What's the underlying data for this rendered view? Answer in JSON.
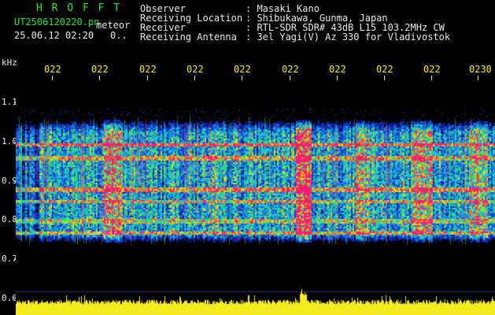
{
  "header": {
    "brand": "H R O F F T",
    "file_name": "UT2506120220.pn",
    "file_tag": "meteor",
    "date_time": "25.06.12 02:20",
    "count": "0..",
    "fields": [
      {
        "label": "Observer",
        "value": "Masaki Kano"
      },
      {
        "label": "Receiving Location",
        "value": "Shibukawa, Gunma, Japan"
      },
      {
        "label": "Receiver",
        "value": "RTL-SDR SDR# 43dB L15 103.2MHz CW"
      },
      {
        "label": "Receiving Antenna",
        "value": "3el Yagi(V) Az 330 for Vladivostok"
      }
    ]
  },
  "spectrogram": {
    "unit_label": "kHz",
    "faint_label": "meteor",
    "y_ticks": [
      "1.1",
      "1.0",
      "0.9",
      "0.8",
      "0.7",
      "0.6"
    ],
    "x_ticks": [
      "022",
      "022",
      "022",
      "022",
      "022",
      "022",
      "022",
      "022",
      "022",
      "0230"
    ],
    "colors": {
      "background": "#000000",
      "noise_floor": "#0a1a8a",
      "signal_high": "#ff1e6e",
      "echo_strip": "#f4ec1d"
    }
  }
}
